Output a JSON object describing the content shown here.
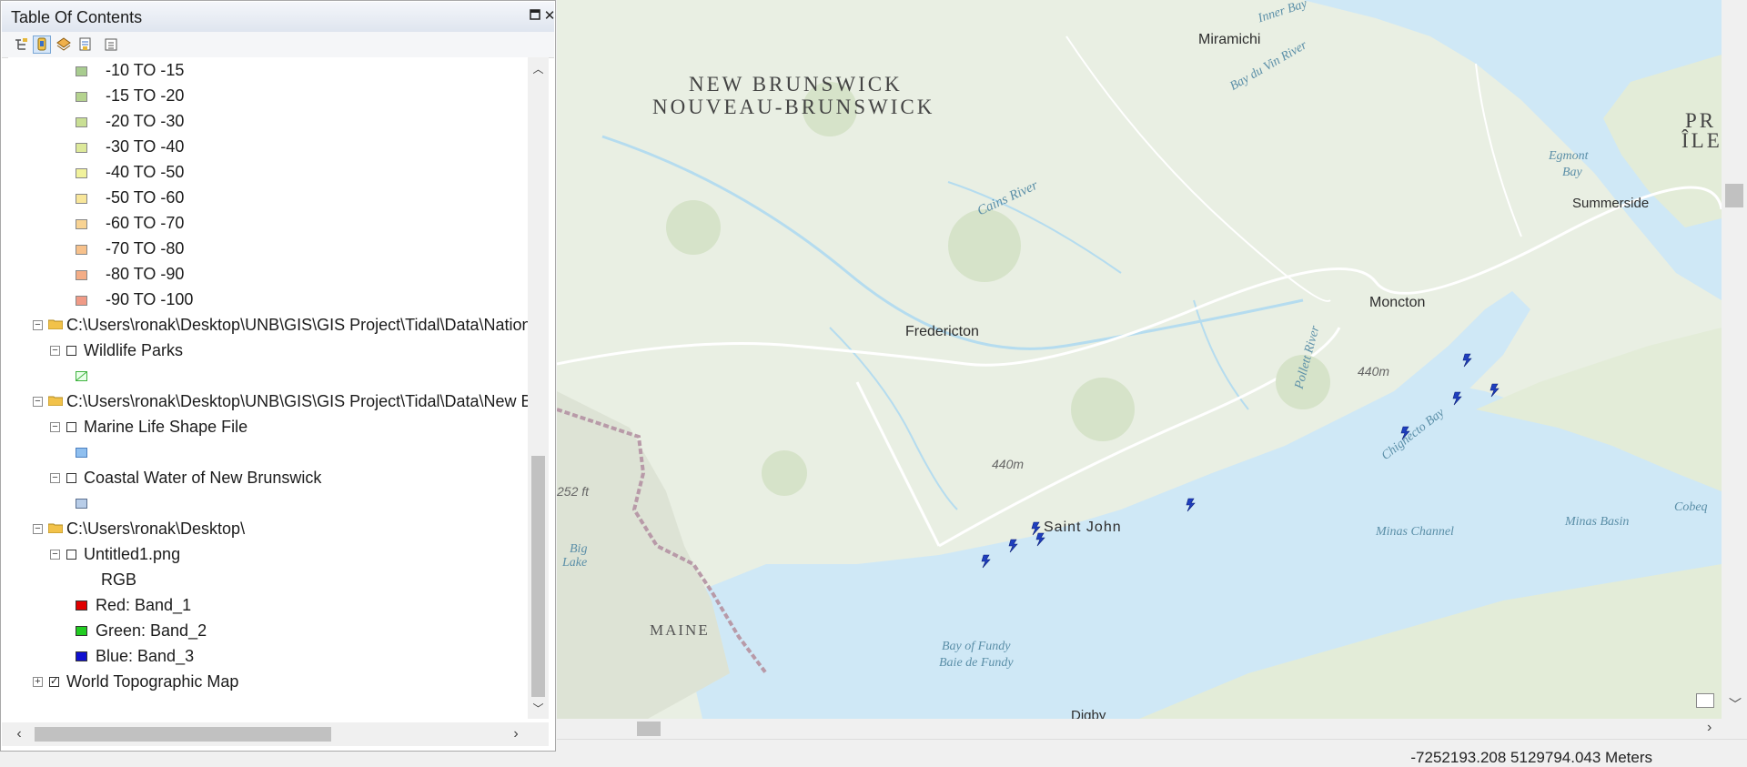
{
  "toc": {
    "title": "Table Of Contents",
    "pin_icon": "restore-icon",
    "close_icon": "close-icon",
    "toolbar_icons": [
      "list-by-drawing-order-icon",
      "list-by-source-icon",
      "list-by-visibility-icon",
      "list-by-selection-icon",
      "options-icon"
    ],
    "legend_classes": [
      {
        "label": "-10 TO   -15",
        "color": "#a8cc8f"
      },
      {
        "label": "-15 TO   -20",
        "color": "#b5d38f"
      },
      {
        "label": "-20 TO   -30",
        "color": "#c9df94"
      },
      {
        "label": "-30 TO   -40",
        "color": "#dde99a"
      },
      {
        "label": "-40 TO   -50",
        "color": "#f1f29c"
      },
      {
        "label": "-50 TO   -60",
        "color": "#f8e69a"
      },
      {
        "label": "-60 TO   -70",
        "color": "#f8d393"
      },
      {
        "label": "-70 TO   -80",
        "color": "#f7c18b"
      },
      {
        "label": "-80 TO   -90",
        "color": "#f4ad86"
      },
      {
        "label": "-90 TO   -100",
        "color": "#f09a86"
      }
    ],
    "folder1": "C:\\Users\\ronak\\Desktop\\UNB\\GIS\\GIS Project\\Tidal\\Data\\National",
    "layer_wildlife": "Wildlife Parks",
    "folder2": "C:\\Users\\ronak\\Desktop\\UNB\\GIS\\GIS Project\\Tidal\\Data\\New Brunswick",
    "layer_marine": "Marine Life Shape File",
    "layer_coastal": "Coastal Water of New Brunswick",
    "folder3": "C:\\Users\\ronak\\Desktop\\",
    "layer_png": "Untitled1.png",
    "rgb_label": "RGB",
    "band_red": "Red:    Band_1",
    "band_green": "Green: Band_2",
    "band_blue": "Blue:   Band_3",
    "basemap": "World Topographic Map",
    "colors": {
      "red": "#e00000",
      "green": "#22cc22",
      "blue": "#1010d0",
      "wildlife": "#9be69b",
      "marine": "#8fbfef",
      "coastal": "#b8cde8"
    }
  },
  "map": {
    "labels": {
      "nb_en": "NEW BRUNSWICK",
      "nb_fr": "NOUVEAU-BRUNSWICK",
      "miramichi": "Miramichi",
      "inner_bay": "Inner Bay",
      "bay_du_vin": "Bay du Vin River",
      "cains": "Cains River",
      "fredericton": "Fredericton",
      "moncton": "Moncton",
      "pollett": "Pollett River",
      "elev1": "440m",
      "elev2": "440m",
      "saint_john": "Saint John",
      "chignecto": "Chignecto Bay",
      "minas_channel": "Minas Channel",
      "minas_basin": "Minas Basin",
      "cobeq": "Cobeq",
      "egmont": "Egmont",
      "egmont_bay": "Bay",
      "summerside": "Summerside",
      "pe1": "PR",
      "pe2": "ÎLE",
      "maine": "MAINE",
      "big_lake_1": "Big",
      "big_lake_2": "Lake",
      "ft": "252 ft",
      "fundy_en": "Bay of Fundy",
      "fundy_fr": "Baie de Fundy",
      "digby": "Digby"
    },
    "marker_icon": "tidal-site-lightning-icon",
    "colors": {
      "land": "#e9efe3",
      "water": "#cfe8f6",
      "river": "#b5dcef",
      "road": "#ffffff",
      "border": "#b89aa8",
      "marker": "#1f3fbf"
    }
  },
  "status": {
    "coordinates": "-7252193.208  5129794.043 Meters"
  }
}
